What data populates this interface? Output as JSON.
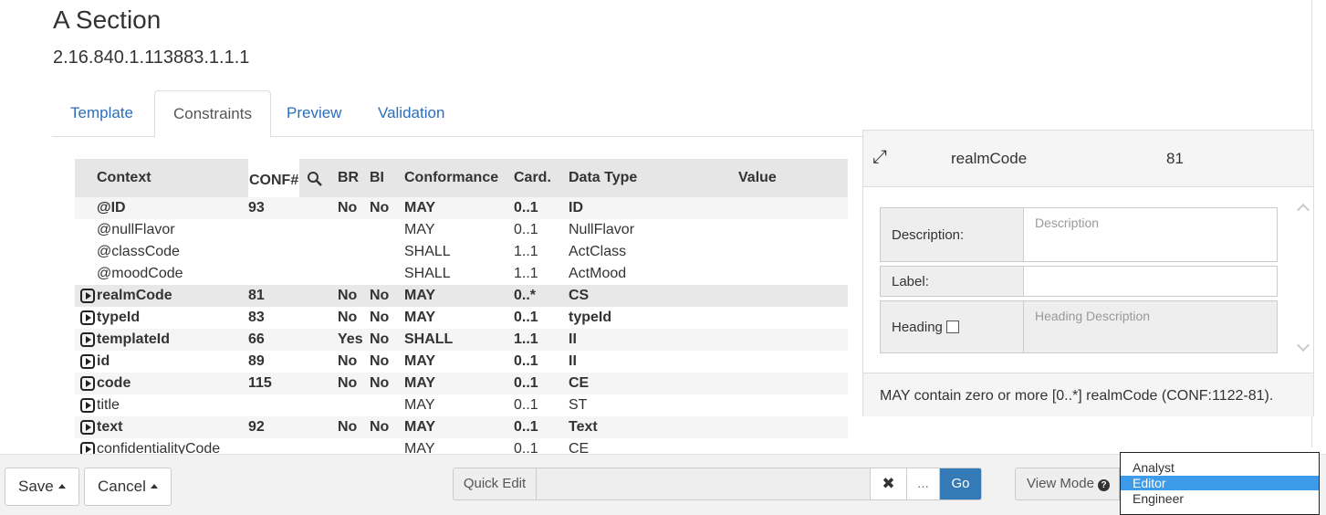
{
  "page": {
    "title": "A Section",
    "oid": "2.16.840.1.113883.1.1.1"
  },
  "tabs": [
    {
      "label": "Template"
    },
    {
      "label": "Constraints"
    },
    {
      "label": "Preview"
    },
    {
      "label": "Validation"
    }
  ],
  "active_tab": "Constraints",
  "table": {
    "headers": {
      "context": "Context",
      "conf": "CONF#",
      "br": "BR",
      "bi": "BI",
      "conformance": "Conformance",
      "card": "Card.",
      "datatype": "Data Type",
      "value": "Value"
    },
    "rows": [
      {
        "context": "@ID",
        "conf": "93",
        "br": "No",
        "bi": "No",
        "conformance": "MAY",
        "card": "0..1",
        "datatype": "ID",
        "value": ""
      },
      {
        "context": "@nullFlavor",
        "conf": "",
        "br": "",
        "bi": "",
        "conformance": "MAY",
        "card": "0..1",
        "datatype": "NullFlavor",
        "value": ""
      },
      {
        "context": "@classCode",
        "conf": "",
        "br": "",
        "bi": "",
        "conformance": "SHALL",
        "card": "1..1",
        "datatype": "ActClass",
        "value": ""
      },
      {
        "context": "@moodCode",
        "conf": "",
        "br": "",
        "bi": "",
        "conformance": "SHALL",
        "card": "1..1",
        "datatype": "ActMood",
        "value": ""
      },
      {
        "context": "realmCode",
        "conf": "81",
        "br": "No",
        "bi": "No",
        "conformance": "MAY",
        "card": "0..*",
        "datatype": "CS",
        "value": ""
      },
      {
        "context": "typeId",
        "conf": "83",
        "br": "No",
        "bi": "No",
        "conformance": "MAY",
        "card": "0..1",
        "datatype": "typeId",
        "value": ""
      },
      {
        "context": "templateId",
        "conf": "66",
        "br": "Yes",
        "bi": "No",
        "conformance": "SHALL",
        "card": "1..1",
        "datatype": "II",
        "value": ""
      },
      {
        "context": "id",
        "conf": "89",
        "br": "No",
        "bi": "No",
        "conformance": "MAY",
        "card": "0..1",
        "datatype": "II",
        "value": ""
      },
      {
        "context": "code",
        "conf": "115",
        "br": "No",
        "bi": "No",
        "conformance": "MAY",
        "card": "0..1",
        "datatype": "CE",
        "value": ""
      },
      {
        "context": "title",
        "conf": "",
        "br": "",
        "bi": "",
        "conformance": "MAY",
        "card": "0..1",
        "datatype": "ST",
        "value": ""
      },
      {
        "context": "text",
        "conf": "92",
        "br": "No",
        "bi": "No",
        "conformance": "MAY",
        "card": "0..1",
        "datatype": "Text",
        "value": ""
      },
      {
        "context": "confidentialityCode",
        "conf": "",
        "br": "",
        "bi": "",
        "conformance": "MAY",
        "card": "0..1",
        "datatype": "CE",
        "value": ""
      }
    ]
  },
  "detail": {
    "name": "realmCode",
    "number": "81",
    "description_label": "Description:",
    "description_placeholder": "Description",
    "label_label": "Label:",
    "label_value": "",
    "heading_label": "Heading",
    "heading_placeholder": "Heading Description",
    "summary": "MAY contain zero or more [0..*] realmCode (CONF:1122-81)."
  },
  "footer": {
    "save_label": "Save",
    "cancel_label": "Cancel",
    "quick_edit_label": "Quick Edit",
    "clear_symbol": "✖",
    "dots_label": "...",
    "go_label": "Go",
    "view_mode_label": "View Mode"
  },
  "view_mode_options": [
    "Analyst",
    "Editor",
    "Engineer"
  ],
  "view_mode_selected": "Editor",
  "colors": {
    "link": "#2a6ebb",
    "go_button": "#337ab7",
    "selected_option": "#3d9be9"
  }
}
